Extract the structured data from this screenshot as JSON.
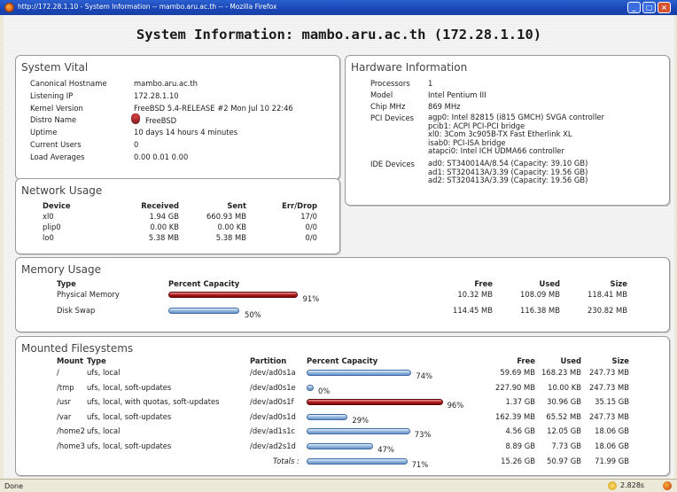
{
  "window": {
    "title": "http://172.28.1.10 - System Information -- mambo.aru.ac.th -- - Mozilla Firefox"
  },
  "page_title": "System Information: mambo.aru.ac.th (172.28.1.10)",
  "vital": {
    "title": "System Vital",
    "rows": [
      {
        "label": "Canonical Hostname",
        "value": "mambo.aru.ac.th"
      },
      {
        "label": "Listening IP",
        "value": "172.28.1.10"
      },
      {
        "label": "Kernel Version",
        "value": "FreeBSD 5.4-RELEASE #2 Mon Jul 10 22:46"
      },
      {
        "label": "Distro Name",
        "value": "FreeBSD",
        "icon": "freebsd-daemon-icon"
      },
      {
        "label": "Uptime",
        "value": "10 days 14 hours 4 minutes"
      },
      {
        "label": "Current Users",
        "value": "0"
      },
      {
        "label": "Load Averages",
        "value": "0.00 0.01 0.00"
      }
    ]
  },
  "hardware": {
    "title": "Hardware Information",
    "processors_label": "Processors",
    "processors": "1",
    "model_label": "Model",
    "model": "Intel Pentium III",
    "chip_label": "Chip MHz",
    "chip": "869 MHz",
    "pci_label": "PCI Devices",
    "pci": [
      "agp0: Intel 82815 (i815 GMCH) SVGA controller",
      "pcib1: ACPI PCI-PCI bridge",
      "xl0: 3Com 3c905B-TX Fast Etherlink XL",
      "isab0: PCI-ISA bridge",
      "atapci0: Intel ICH UDMA66 controller"
    ],
    "ide_label": "IDE Devices",
    "ide": [
      "ad0: ST340014A/8.54 (Capacity: 39.10 GB)",
      "ad1: ST320413A/3.39 (Capacity: 19.56 GB)",
      "ad2: ST320413A/3.39 (Capacity: 19.56 GB)"
    ]
  },
  "network": {
    "title": "Network Usage",
    "headers": {
      "device": "Device",
      "received": "Received",
      "sent": "Sent",
      "errdrop": "Err/Drop"
    },
    "rows": [
      {
        "device": "xl0",
        "received": "1.94 GB",
        "sent": "660.93 MB",
        "errdrop": "17/0"
      },
      {
        "device": "plip0",
        "received": "0.00 KB",
        "sent": "0.00 KB",
        "errdrop": "0/0"
      },
      {
        "device": "lo0",
        "received": "5.38 MB",
        "sent": "5.38 MB",
        "errdrop": "0/0"
      }
    ]
  },
  "memory": {
    "title": "Memory Usage",
    "headers": {
      "type": "Type",
      "percent": "Percent Capacity",
      "free": "Free",
      "used": "Used",
      "size": "Size"
    },
    "rows": [
      {
        "type": "Physical Memory",
        "percent": 91,
        "percent_label": "91%",
        "free": "10.32 MB",
        "used": "108.09 MB",
        "size": "118.41 MB",
        "bar_color": "red"
      },
      {
        "type": "Disk Swap",
        "percent": 50,
        "percent_label": "50%",
        "free": "114.45 MB",
        "used": "116.38 MB",
        "size": "230.82 MB",
        "bar_color": "blue"
      }
    ]
  },
  "filesystems": {
    "title": "Mounted Filesystems",
    "headers": {
      "mount": "Mount",
      "type": "Type",
      "partition": "Partition",
      "percent": "Percent Capacity",
      "free": "Free",
      "used": "Used",
      "size": "Size"
    },
    "rows": [
      {
        "mount": "/",
        "type": "ufs, local",
        "partition": "/dev/ad0s1a",
        "percent": 74,
        "percent_label": "74%",
        "free": "59.69 MB",
        "used": "168.23 MB",
        "size": "247.73 MB",
        "bar_color": "blue"
      },
      {
        "mount": "/tmp",
        "type": "ufs, local, soft-updates",
        "partition": "/dev/ad0s1e",
        "percent": 0,
        "percent_label": "0%",
        "free": "227.90 MB",
        "used": "10.00 KB",
        "size": "247.73 MB",
        "bar_color": "blue"
      },
      {
        "mount": "/usr",
        "type": "ufs, local, with quotas, soft-updates",
        "partition": "/dev/ad0s1f",
        "percent": 96,
        "percent_label": "96%",
        "free": "1.37 GB",
        "used": "30.96 GB",
        "size": "35.15 GB",
        "bar_color": "red"
      },
      {
        "mount": "/var",
        "type": "ufs, local, soft-updates",
        "partition": "/dev/ad0s1d",
        "percent": 29,
        "percent_label": "29%",
        "free": "162.39 MB",
        "used": "65.52 MB",
        "size": "247.73 MB",
        "bar_color": "blue"
      },
      {
        "mount": "/home2",
        "type": "ufs, local",
        "partition": "/dev/ad1s1c",
        "percent": 73,
        "percent_label": "73%",
        "free": "4.56 GB",
        "used": "12.05 GB",
        "size": "18.06 GB",
        "bar_color": "blue"
      },
      {
        "mount": "/home3",
        "type": "ufs, local, soft-updates",
        "partition": "/dev/ad2s1d",
        "percent": 47,
        "percent_label": "47%",
        "free": "8.89 GB",
        "used": "7.73 GB",
        "size": "18.06 GB",
        "bar_color": "blue"
      }
    ],
    "totals": {
      "label": "Totals :",
      "percent": 71,
      "percent_label": "71%",
      "free": "15.26 GB",
      "used": "50.97 GB",
      "size": "71.99 GB",
      "bar_color": "blue"
    }
  },
  "statusbar": {
    "status": "Done",
    "time": "2.828s"
  }
}
